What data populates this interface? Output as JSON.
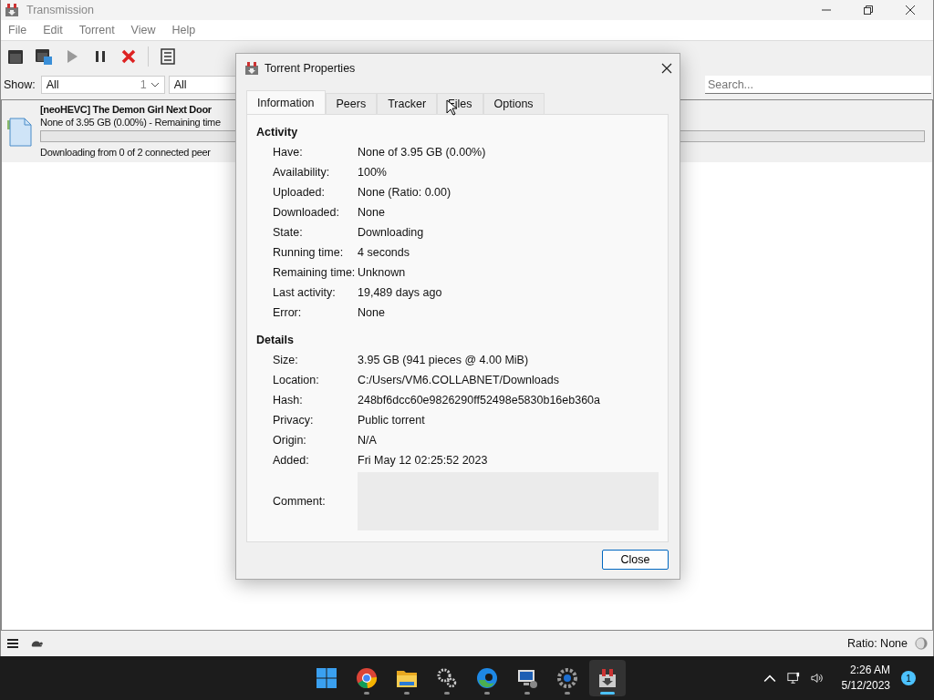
{
  "window": {
    "title": "Transmission"
  },
  "menu": [
    "File",
    "Edit",
    "Torrent",
    "View",
    "Help"
  ],
  "toolbar": [
    {
      "kind": "open",
      "disabled": false
    },
    {
      "kind": "open-url",
      "disabled": false
    },
    {
      "kind": "start",
      "disabled": true
    },
    {
      "kind": "pause",
      "disabled": false
    },
    {
      "kind": "remove",
      "disabled": false
    },
    {
      "kind": "properties",
      "disabled": false
    }
  ],
  "filter": {
    "label": "Show:",
    "activity": "All",
    "count": "1",
    "tracker": "All",
    "search": {
      "placeholder": "Search..."
    }
  },
  "torrents": [
    {
      "name": "[neoHEVC] The Demon Girl Next Door",
      "progress": "None of 3.95 GB (0.00%) - Remaining time",
      "level": 0,
      "status": "Downloading from 0 of 2 connected peer"
    }
  ],
  "status_bar": {
    "ratio": "Ratio: None"
  },
  "dialog": {
    "title": "Torrent Properties",
    "tabs": [
      {
        "label": "Information",
        "selected": true
      },
      {
        "label": "Peers",
        "selected": false
      },
      {
        "label": "Tracker",
        "selected": false
      },
      {
        "label": "Files",
        "selected": false
      },
      {
        "label": "Options",
        "selected": false
      }
    ],
    "sections": [
      {
        "title": "Activity",
        "fields": [
          {
            "label": "Have:",
            "kind": "text",
            "value": "None of 3.95 GB (0.00%)"
          },
          {
            "label": "Availability:",
            "kind": "text",
            "value": "100%"
          },
          {
            "label": "Uploaded:",
            "kind": "text",
            "value": "None (Ratio: 0.00)"
          },
          {
            "label": "Downloaded:",
            "kind": "text",
            "value": "None"
          },
          {
            "label": "State:",
            "kind": "text",
            "value": "Downloading"
          },
          {
            "label": "Running time:",
            "kind": "text",
            "value": "4 seconds"
          },
          {
            "label": "Remaining time:",
            "kind": "text",
            "value": "Unknown"
          },
          {
            "label": "Last activity:",
            "kind": "text",
            "value": "19,489 days ago"
          },
          {
            "label": "Error:",
            "kind": "text",
            "value": "None"
          }
        ]
      },
      {
        "title": "Details",
        "fields": [
          {
            "label": "Size:",
            "kind": "text",
            "value": "3.95 GB (941 pieces @ 4.00 MiB)"
          },
          {
            "label": "Location:",
            "kind": "text",
            "value": "C:/Users/VM6.COLLABNET/Downloads"
          },
          {
            "label": "Hash:",
            "kind": "text",
            "value": "248bf6dcc60e9826290ff52498e5830b16eb360a"
          },
          {
            "label": "Privacy:",
            "kind": "text",
            "value": "Public torrent"
          },
          {
            "label": "Origin:",
            "kind": "text",
            "value": "N/A"
          },
          {
            "label": "Added:",
            "kind": "text",
            "value": "Fri May 12 02:25:52 2023"
          },
          {
            "label": "Comment:",
            "kind": "textarea"
          }
        ]
      }
    ],
    "buttons": [
      "Close"
    ]
  },
  "taskbar": {
    "apps": [
      {
        "kind": "start",
        "active": false
      },
      {
        "kind": "chrome",
        "active": false
      },
      {
        "kind": "folder",
        "active": false
      },
      {
        "kind": "gears",
        "active": false
      },
      {
        "kind": "edge",
        "active": false
      },
      {
        "kind": "remote",
        "active": false
      },
      {
        "kind": "settings",
        "active": false
      },
      {
        "kind": "transmission",
        "active": true
      }
    ],
    "time": "2:26 AM",
    "date": "5/12/2023",
    "notifications": "1"
  }
}
